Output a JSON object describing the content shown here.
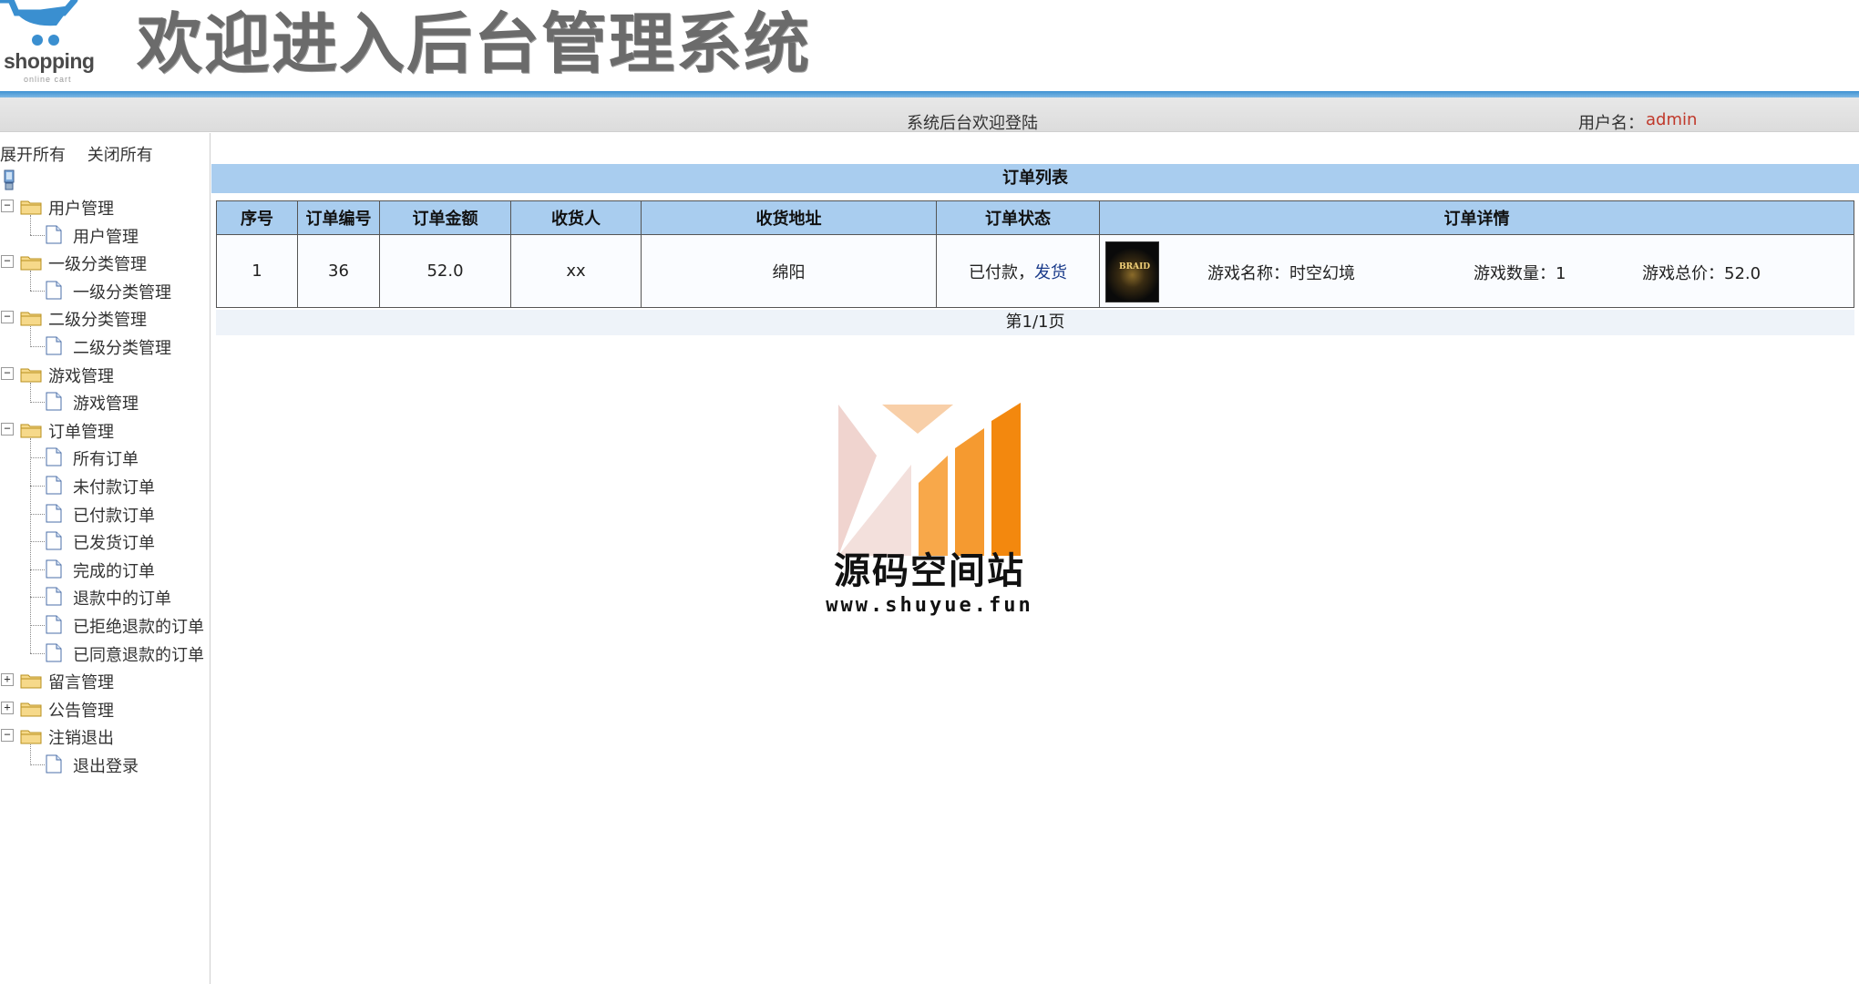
{
  "header": {
    "logo_text": "shopping",
    "logo_sub": "online cart",
    "title": "欢迎进入后台管理系统",
    "welcome": "系统后台欢迎登陆",
    "user_label": "用户名：",
    "user_name": "admin"
  },
  "sidebar": {
    "expand_all": "展开所有",
    "collapse_all": "关闭所有",
    "groups": [
      {
        "label": "用户管理",
        "expanded": true,
        "items": [
          "用户管理"
        ]
      },
      {
        "label": "一级分类管理",
        "expanded": true,
        "items": [
          "一级分类管理"
        ]
      },
      {
        "label": "二级分类管理",
        "expanded": true,
        "items": [
          "二级分类管理"
        ]
      },
      {
        "label": "游戏管理",
        "expanded": true,
        "items": [
          "游戏管理"
        ]
      },
      {
        "label": "订单管理",
        "expanded": true,
        "items": [
          "所有订单",
          "未付款订单",
          "已付款订单",
          "已发货订单",
          "完成的订单",
          "退款中的订单",
          "已拒绝退款的订单",
          "已同意退款的订单"
        ]
      },
      {
        "label": "留言管理",
        "expanded": false,
        "items": []
      },
      {
        "label": "公告管理",
        "expanded": false,
        "items": []
      },
      {
        "label": "注销退出",
        "expanded": true,
        "items": [
          "退出登录"
        ]
      }
    ]
  },
  "main": {
    "panel_title": "订单列表",
    "columns": [
      "序号",
      "订单编号",
      "订单金额",
      "收货人",
      "收货地址",
      "订单状态",
      "订单详情"
    ],
    "rows": [
      {
        "index": "1",
        "order_no": "36",
        "amount": "52.0",
        "receiver": "xx",
        "address": "绵阳",
        "status": "已付款，",
        "status_action": "发货",
        "detail": {
          "thumb_text": "BRAID",
          "game_name": "游戏名称：时空幻境",
          "game_count": "游戏数量：1",
          "game_total": "游戏总价：52.0"
        }
      }
    ],
    "pager": "第1/1页"
  },
  "watermark": {
    "cn": "源码空间站",
    "url": "www.shuyue.fun"
  },
  "colors": {
    "header_blue": "#3f92d2",
    "table_header": "#a9cdef",
    "user_name": "#c0392b",
    "link": "#1a3b8a"
  }
}
